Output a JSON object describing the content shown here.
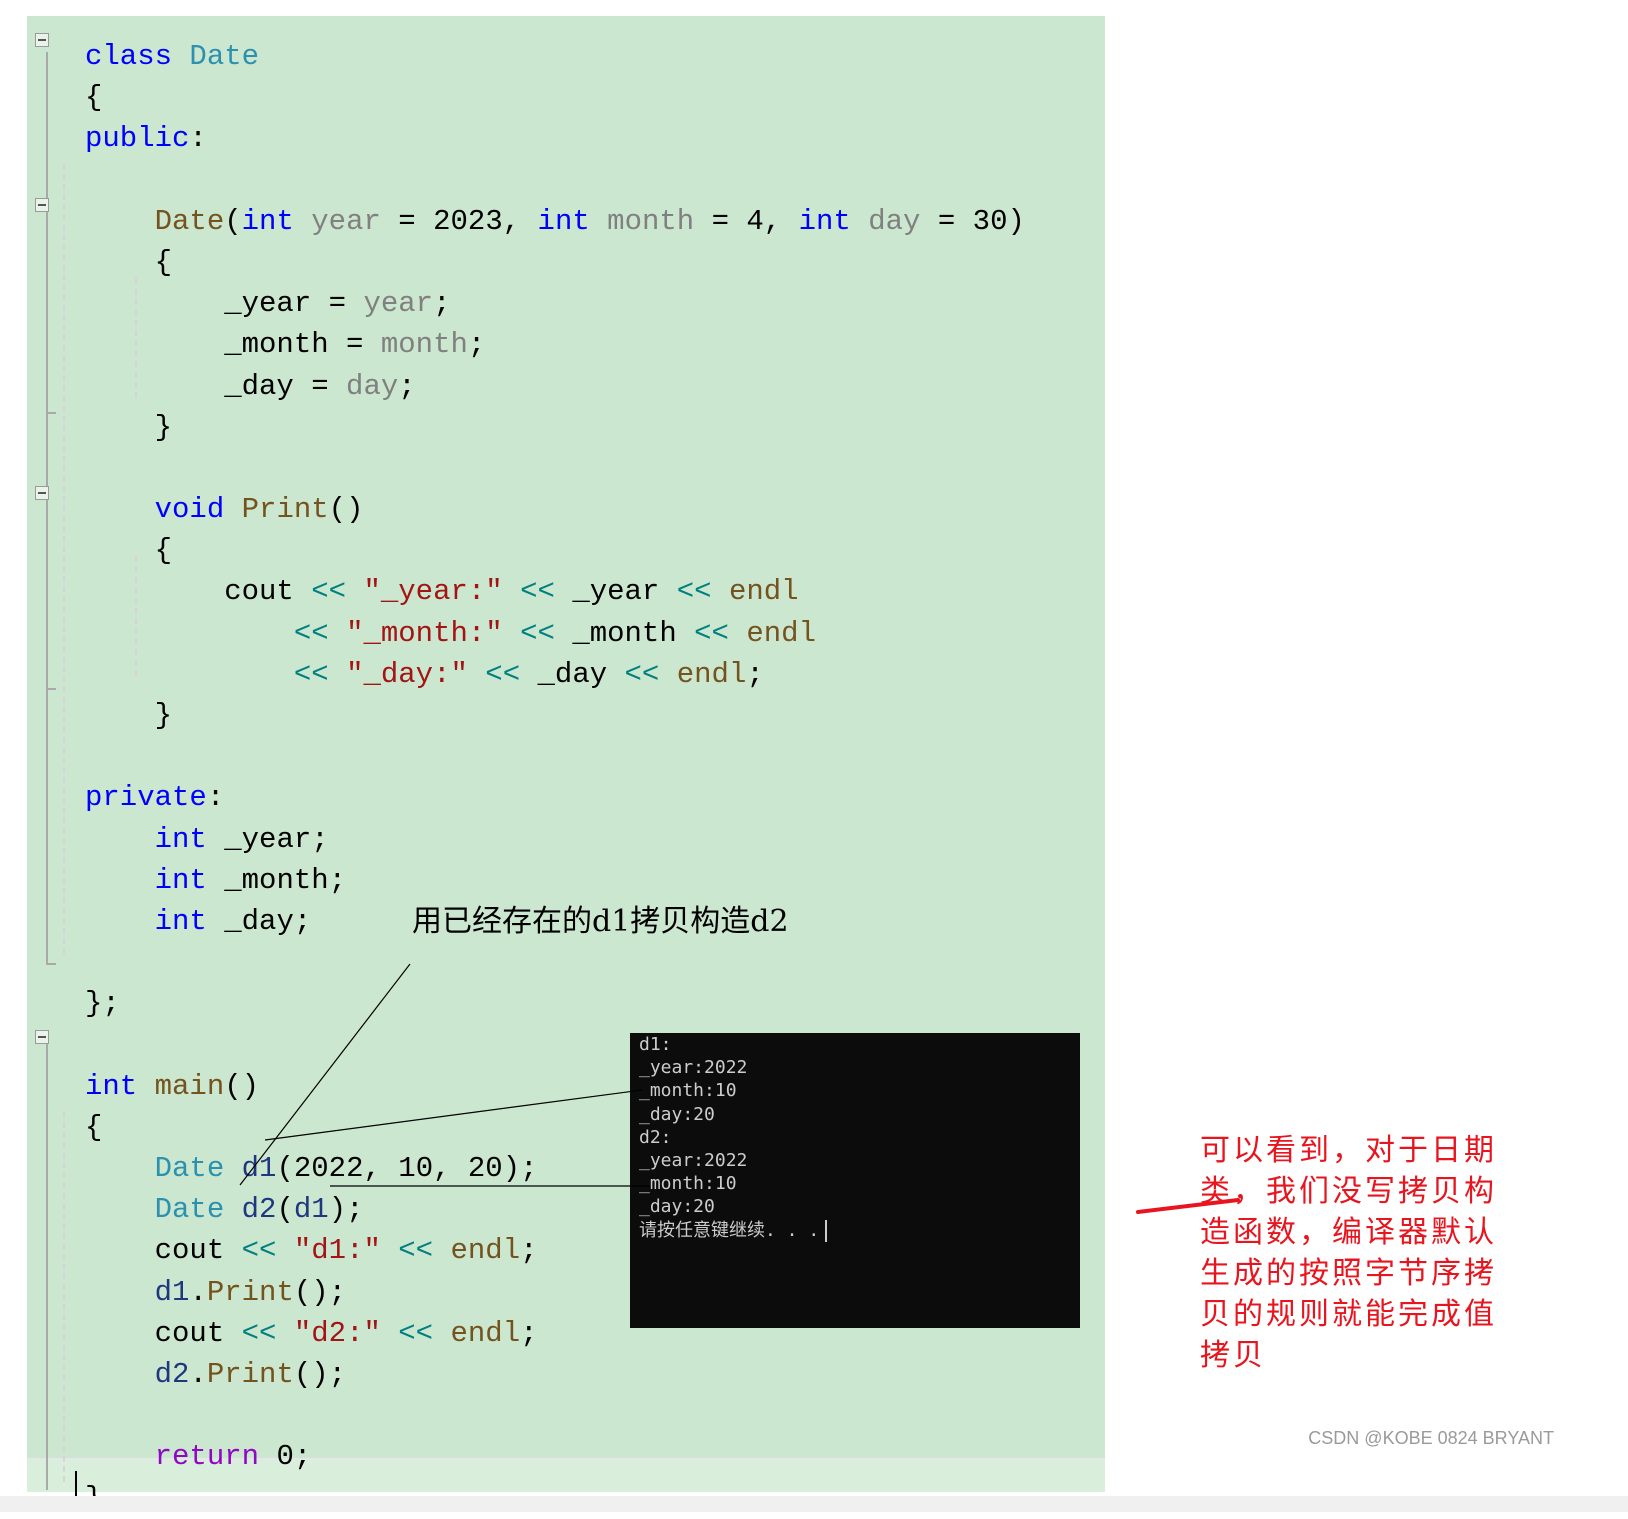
{
  "code_lines": [
    [
      {
        "c": "kw",
        "t": "class"
      },
      {
        "c": "pl",
        "t": " "
      },
      {
        "c": "ty",
        "t": "Date"
      }
    ],
    [
      {
        "c": "pl",
        "t": "{"
      }
    ],
    [
      {
        "c": "kw",
        "t": "public"
      },
      {
        "c": "pl",
        "t": ":"
      }
    ],
    [],
    [
      {
        "c": "pl",
        "t": "    "
      },
      {
        "c": "fn",
        "t": "Date"
      },
      {
        "c": "pl",
        "t": "("
      },
      {
        "c": "kw",
        "t": "int"
      },
      {
        "c": "pl",
        "t": " "
      },
      {
        "c": "pa",
        "t": "year"
      },
      {
        "c": "pl",
        "t": " = 2023, "
      },
      {
        "c": "kw",
        "t": "int"
      },
      {
        "c": "pl",
        "t": " "
      },
      {
        "c": "pa",
        "t": "month"
      },
      {
        "c": "pl",
        "t": " = 4, "
      },
      {
        "c": "kw",
        "t": "int"
      },
      {
        "c": "pl",
        "t": " "
      },
      {
        "c": "pa",
        "t": "day"
      },
      {
        "c": "pl",
        "t": " = 30)"
      }
    ],
    [
      {
        "c": "pl",
        "t": "    {"
      }
    ],
    [
      {
        "c": "pl",
        "t": "        _year = "
      },
      {
        "c": "pa",
        "t": "year"
      },
      {
        "c": "pl",
        "t": ";"
      }
    ],
    [
      {
        "c": "pl",
        "t": "        _month = "
      },
      {
        "c": "pa",
        "t": "month"
      },
      {
        "c": "pl",
        "t": ";"
      }
    ],
    [
      {
        "c": "pl",
        "t": "        _day = "
      },
      {
        "c": "pa",
        "t": "day"
      },
      {
        "c": "pl",
        "t": ";"
      }
    ],
    [
      {
        "c": "pl",
        "t": "    }"
      }
    ],
    [],
    [
      {
        "c": "pl",
        "t": "    "
      },
      {
        "c": "kw",
        "t": "void"
      },
      {
        "c": "pl",
        "t": " "
      },
      {
        "c": "fn",
        "t": "Print"
      },
      {
        "c": "pl",
        "t": "()"
      }
    ],
    [
      {
        "c": "pl",
        "t": "    {"
      }
    ],
    [
      {
        "c": "pl",
        "t": "        cout "
      },
      {
        "c": "op",
        "t": "<<"
      },
      {
        "c": "pl",
        "t": " "
      },
      {
        "c": "st",
        "t": "\"_year:\""
      },
      {
        "c": "pl",
        "t": " "
      },
      {
        "c": "op",
        "t": "<<"
      },
      {
        "c": "pl",
        "t": " _year "
      },
      {
        "c": "op",
        "t": "<<"
      },
      {
        "c": "pl",
        "t": " "
      },
      {
        "c": "fn",
        "t": "endl"
      }
    ],
    [
      {
        "c": "pl",
        "t": "            "
      },
      {
        "c": "op",
        "t": "<<"
      },
      {
        "c": "pl",
        "t": " "
      },
      {
        "c": "st",
        "t": "\"_month:\""
      },
      {
        "c": "pl",
        "t": " "
      },
      {
        "c": "op",
        "t": "<<"
      },
      {
        "c": "pl",
        "t": " _month "
      },
      {
        "c": "op",
        "t": "<<"
      },
      {
        "c": "pl",
        "t": " "
      },
      {
        "c": "fn",
        "t": "endl"
      }
    ],
    [
      {
        "c": "pl",
        "t": "            "
      },
      {
        "c": "op",
        "t": "<<"
      },
      {
        "c": "pl",
        "t": " "
      },
      {
        "c": "st",
        "t": "\"_day:\""
      },
      {
        "c": "pl",
        "t": " "
      },
      {
        "c": "op",
        "t": "<<"
      },
      {
        "c": "pl",
        "t": " _day "
      },
      {
        "c": "op",
        "t": "<<"
      },
      {
        "c": "pl",
        "t": " "
      },
      {
        "c": "fn",
        "t": "endl"
      },
      {
        "c": "pl",
        "t": ";"
      }
    ],
    [
      {
        "c": "pl",
        "t": "    }"
      }
    ],
    [],
    [
      {
        "c": "kw",
        "t": "private"
      },
      {
        "c": "pl",
        "t": ":"
      }
    ],
    [
      {
        "c": "pl",
        "t": "    "
      },
      {
        "c": "kw",
        "t": "int"
      },
      {
        "c": "pl",
        "t": " _year;"
      }
    ],
    [
      {
        "c": "pl",
        "t": "    "
      },
      {
        "c": "kw",
        "t": "int"
      },
      {
        "c": "pl",
        "t": " _month;"
      }
    ],
    [
      {
        "c": "pl",
        "t": "    "
      },
      {
        "c": "kw",
        "t": "int"
      },
      {
        "c": "pl",
        "t": " _day;"
      }
    ],
    [],
    [
      {
        "c": "pl",
        "t": "};"
      }
    ],
    [],
    [
      {
        "c": "kw",
        "t": "int"
      },
      {
        "c": "pl",
        "t": " "
      },
      {
        "c": "fn",
        "t": "main"
      },
      {
        "c": "pl",
        "t": "()"
      }
    ],
    [
      {
        "c": "pl",
        "t": "{"
      }
    ],
    [
      {
        "c": "pl",
        "t": "    "
      },
      {
        "c": "ty",
        "t": "Date"
      },
      {
        "c": "pl",
        "t": " "
      },
      {
        "c": "lv",
        "t": "d1"
      },
      {
        "c": "pl",
        "t": "(2022, 10, 20);"
      }
    ],
    [
      {
        "c": "pl",
        "t": "    "
      },
      {
        "c": "ty",
        "t": "Date"
      },
      {
        "c": "pl",
        "t": " "
      },
      {
        "c": "lv",
        "t": "d2"
      },
      {
        "c": "pl",
        "t": "("
      },
      {
        "c": "lv",
        "t": "d1"
      },
      {
        "c": "pl",
        "t": ");"
      }
    ],
    [
      {
        "c": "pl",
        "t": "    cout "
      },
      {
        "c": "op",
        "t": "<<"
      },
      {
        "c": "pl",
        "t": " "
      },
      {
        "c": "st",
        "t": "\"d1:\""
      },
      {
        "c": "pl",
        "t": " "
      },
      {
        "c": "op",
        "t": "<<"
      },
      {
        "c": "pl",
        "t": " "
      },
      {
        "c": "fn",
        "t": "endl"
      },
      {
        "c": "pl",
        "t": ";"
      }
    ],
    [
      {
        "c": "pl",
        "t": "    "
      },
      {
        "c": "lv",
        "t": "d1"
      },
      {
        "c": "pl",
        "t": "."
      },
      {
        "c": "fn",
        "t": "Print"
      },
      {
        "c": "pl",
        "t": "();"
      }
    ],
    [
      {
        "c": "pl",
        "t": "    cout "
      },
      {
        "c": "op",
        "t": "<<"
      },
      {
        "c": "pl",
        "t": " "
      },
      {
        "c": "st",
        "t": "\"d2:\""
      },
      {
        "c": "pl",
        "t": " "
      },
      {
        "c": "op",
        "t": "<<"
      },
      {
        "c": "pl",
        "t": " "
      },
      {
        "c": "fn",
        "t": "endl"
      },
      {
        "c": "pl",
        "t": ";"
      }
    ],
    [
      {
        "c": "pl",
        "t": "    "
      },
      {
        "c": "lv",
        "t": "d2"
      },
      {
        "c": "pl",
        "t": "."
      },
      {
        "c": "fn",
        "t": "Print"
      },
      {
        "c": "pl",
        "t": "();"
      }
    ],
    [],
    [
      {
        "c": "pl",
        "t": "    "
      },
      {
        "c": "rt",
        "t": "return"
      },
      {
        "c": "pl",
        "t": " 0;"
      }
    ],
    [
      {
        "c": "pl",
        "t": "}"
      }
    ]
  ],
  "console": {
    "lines": [
      "d1:",
      "_year:2022",
      "_month:10",
      "_day:20",
      "d2:",
      "_year:2022",
      "_month:10",
      "_day:20",
      "请按任意键继续. . ."
    ]
  },
  "annotations": {
    "copy_note": "用已经存在的d1拷贝构造d2",
    "explanation": "可以看到，对于日期类，我们没写拷贝构造函数，编译器默认生成的按照字节序拷贝的规则就能完成值拷贝"
  },
  "watermark": "CSDN @KOBE 0824 BRYANT",
  "colors": {
    "editor_bg": "#cce7cf",
    "keyword": "#0000ff",
    "type": "#2b91af",
    "function": "#74531f",
    "parameter": "#808080",
    "string": "#a31515",
    "operator": "#008080",
    "return_keyword": "#8f08c4",
    "annotation_red": "#e8141e",
    "console_bg": "#0c0c0c"
  }
}
